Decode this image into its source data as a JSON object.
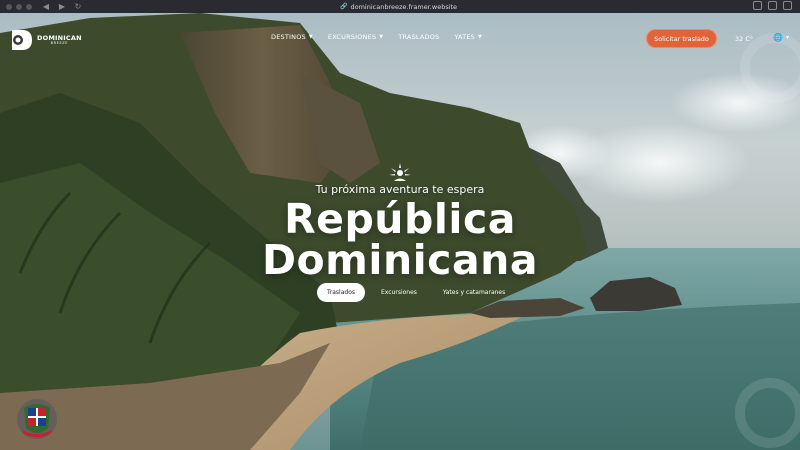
{
  "browser": {
    "url": "dominicanbreeze.framer.website"
  },
  "header": {
    "logo_word": "DOMINICAN",
    "logo_sub": "BREEZE",
    "nav": [
      {
        "label": "DESTINOS",
        "has_dropdown": true
      },
      {
        "label": "EXCURSIONES",
        "has_dropdown": true
      },
      {
        "label": "TRASLADOS",
        "has_dropdown": false
      },
      {
        "label": "YATES",
        "has_dropdown": true
      }
    ],
    "cta_label": "Solicitar traslado",
    "temperature": "32 C°",
    "language_icon": "globe-icon"
  },
  "hero": {
    "tagline": "Tu próxima aventura te espera",
    "title_line1": "República",
    "title_line2": "Dominicana",
    "tabs": [
      {
        "label": "Traslados",
        "active": true
      },
      {
        "label": "Excursiones",
        "active": false
      },
      {
        "label": "Yates y catamaranes",
        "active": false
      }
    ]
  },
  "colors": {
    "accent": "#e0643a",
    "text": "#ffffff",
    "browser_bar": "#2a2b30"
  }
}
